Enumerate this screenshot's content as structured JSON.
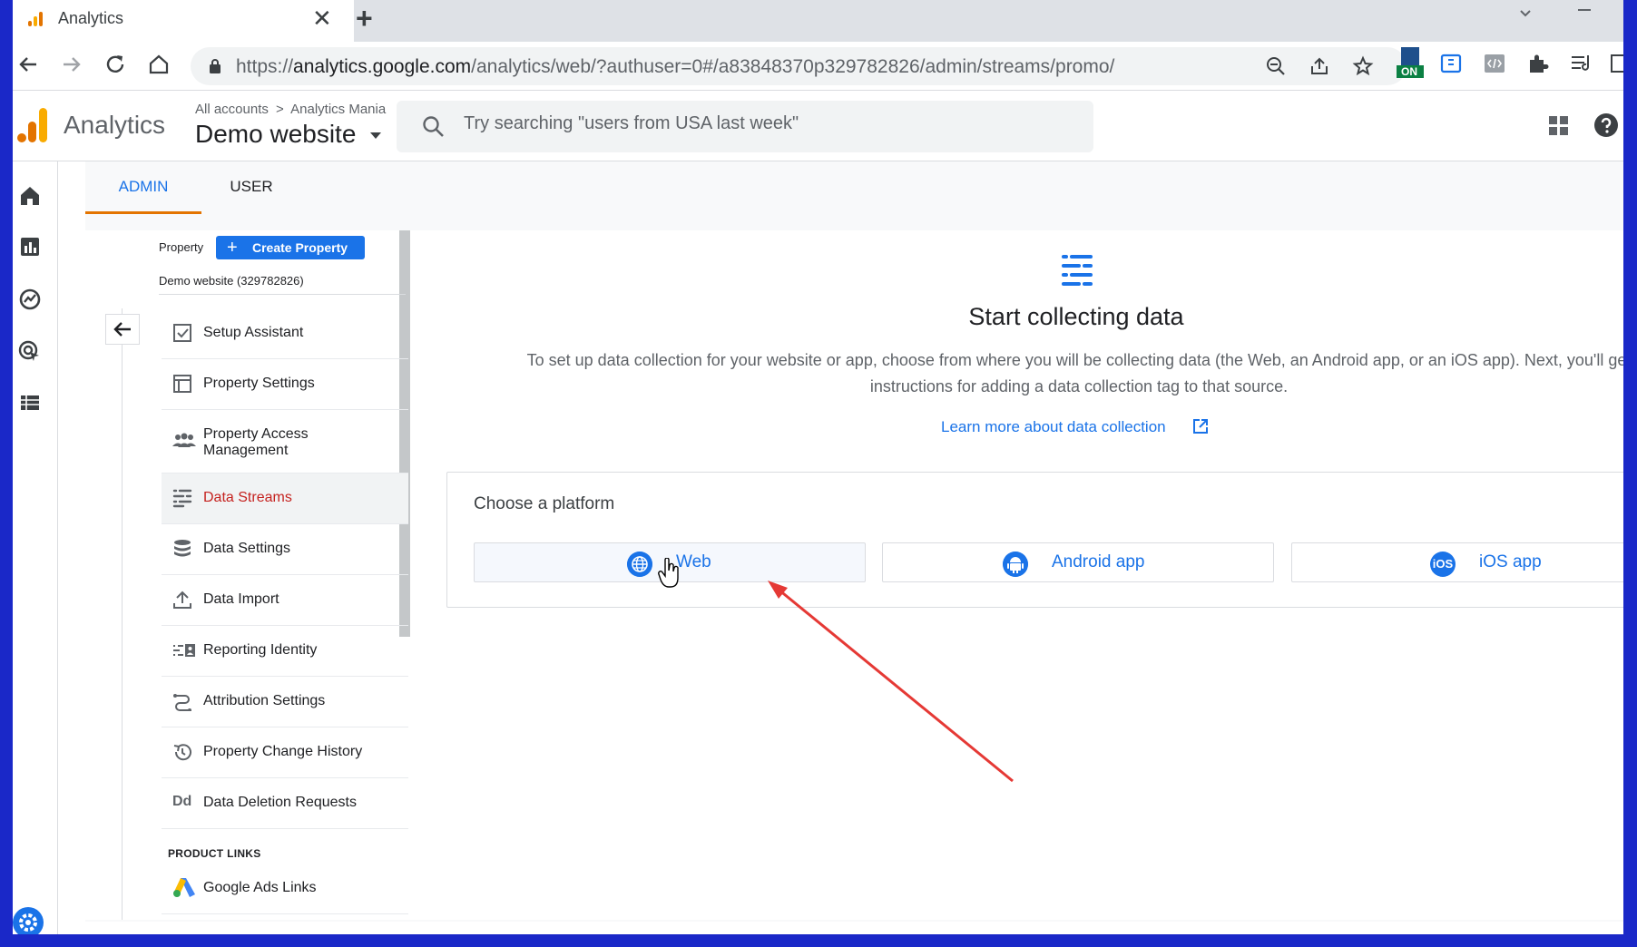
{
  "browser": {
    "tab_title": "Analytics",
    "tab_close": "✕",
    "new_tab": "+",
    "url_prefix": "https://",
    "url_host": "analytics.google.com",
    "url_path": "/analytics/web/?authuser=0#/a83848370p329782826/admin/streams/promo/",
    "extension_badge": "ON"
  },
  "header": {
    "app_name": "Analytics",
    "breadcrumb_all": "All accounts",
    "breadcrumb_sep": ">",
    "breadcrumb_account": "Analytics Mania",
    "property_name": "Demo website",
    "search_placeholder": "Try searching \"users from USA last week\""
  },
  "admin_tabs": [
    {
      "label": "ADMIN",
      "active": true
    },
    {
      "label": "USER",
      "active": false
    }
  ],
  "property_panel": {
    "label": "Property",
    "create_button": "Create Property",
    "property_id_label": "Demo website (329782826)",
    "items": [
      {
        "label": "Setup Assistant",
        "icon": "checkbox-icon"
      },
      {
        "label": "Property Settings",
        "icon": "layout-icon"
      },
      {
        "label": "Property Access Management",
        "icon": "people-icon"
      },
      {
        "label": "Data Streams",
        "icon": "streams-icon",
        "active": true
      },
      {
        "label": "Data Settings",
        "icon": "database-icon"
      },
      {
        "label": "Data Import",
        "icon": "upload-icon"
      },
      {
        "label": "Reporting Identity",
        "icon": "identity-icon"
      },
      {
        "label": "Attribution Settings",
        "icon": "attribution-icon"
      },
      {
        "label": "Property Change History",
        "icon": "history-icon"
      },
      {
        "label": "Data Deletion Requests",
        "icon": "dd-icon"
      }
    ],
    "section_product_links": "PRODUCT LINKS",
    "product_links": [
      {
        "label": "Google Ads Links",
        "icon": "google-ads-icon"
      }
    ],
    "dd_glyph": "Dd"
  },
  "main": {
    "title": "Start collecting data",
    "description": "To set up data collection for your website or app, choose from where you will be collecting data (the Web, an Android app, or an iOS app). Next, you'll get instructions for adding a data collection tag to that source.",
    "learn_more": "Learn more about data collection",
    "choose_platform": "Choose a platform",
    "platforms": [
      {
        "label": "Web",
        "icon": "globe-icon"
      },
      {
        "label": "Android app",
        "icon": "android-icon"
      },
      {
        "label": "iOS app",
        "icon": "ios-icon",
        "glyph": "iOS"
      }
    ]
  },
  "colors": {
    "accent": "#1a73e8",
    "active_nav": "#c5221f",
    "tab_indicator": "#e37400",
    "annotation_arrow": "#e53935",
    "frame_border": "#1a28c8"
  }
}
